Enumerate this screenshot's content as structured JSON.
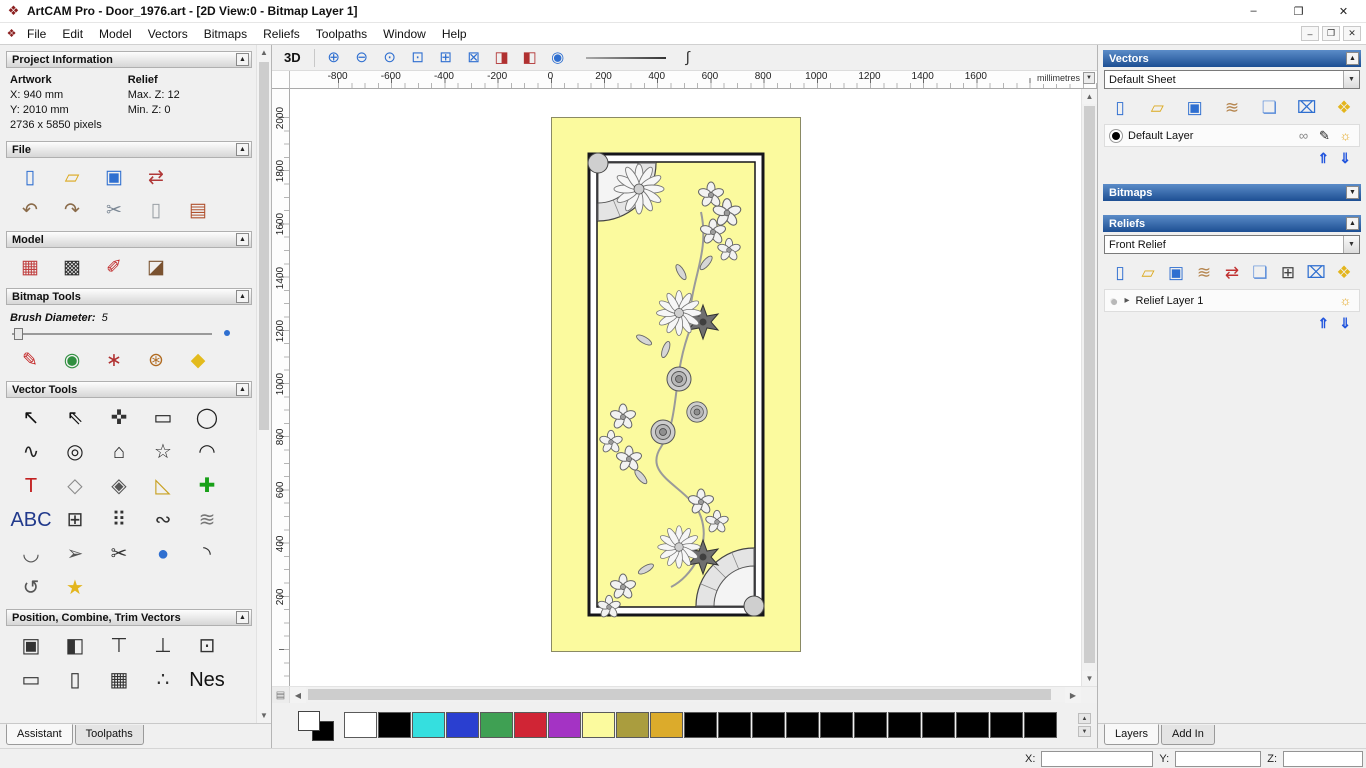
{
  "titlebar": {
    "title": "ArtCAM Pro - Door_1976.art - [2D View:0 - Bitmap Layer 1]",
    "logo_glyph": "❖",
    "minimize_glyph": "–",
    "maximize_glyph": "❐",
    "close_glyph": "✕"
  },
  "menubar": {
    "items": [
      {
        "name": "menu-file",
        "label": "File"
      },
      {
        "name": "menu-edit",
        "label": "Edit"
      },
      {
        "name": "menu-model",
        "label": "Model"
      },
      {
        "name": "menu-vectors",
        "label": "Vectors"
      },
      {
        "name": "menu-bitmaps",
        "label": "Bitmaps"
      },
      {
        "name": "menu-reliefs",
        "label": "Reliefs"
      },
      {
        "name": "menu-toolpaths",
        "label": "Toolpaths"
      },
      {
        "name": "menu-window",
        "label": "Window"
      },
      {
        "name": "menu-help",
        "label": "Help"
      }
    ],
    "child_minimize_glyph": "–",
    "child_restore_glyph": "❐",
    "child_close_glyph": "✕"
  },
  "assistant": {
    "project_info": {
      "title": "Project Information",
      "artwork_heading": "Artwork",
      "relief_heading": "Relief",
      "artwork_x": "X: 940 mm",
      "artwork_y": "Y: 2010 mm",
      "artwork_pixels": "2736 x 5850 pixels",
      "relief_max_z": "Max. Z: 12",
      "relief_min_z": "Min. Z: 0"
    },
    "file_section": {
      "title": "File",
      "icons_row1": [
        {
          "name": "new-model-icon",
          "glyph": "▯",
          "fg": "#2f6fd0"
        },
        {
          "name": "open-model-icon",
          "glyph": "▱",
          "fg": "#dca91e"
        },
        {
          "name": "save-model-icon",
          "glyph": "▣",
          "fg": "#2f6fd0"
        },
        {
          "name": "model-transfer-icon",
          "glyph": "⇄",
          "fg": "#b03838"
        }
      ],
      "icons_row2": [
        {
          "name": "undo-icon",
          "glyph": "↶",
          "fg": "#8a6b4a"
        },
        {
          "name": "redo-icon",
          "glyph": "↷",
          "fg": "#8a6b4a"
        },
        {
          "name": "cut-icon",
          "glyph": "✂",
          "fg": "#7b8794"
        },
        {
          "name": "paste-icon",
          "glyph": "▯",
          "fg": "#9aa0a6"
        },
        {
          "name": "notes-icon",
          "glyph": "▤",
          "fg": "#b0512e"
        }
      ]
    },
    "model_section": {
      "title": "Model",
      "icons": [
        {
          "name": "load-relief-icon",
          "glyph": "▦",
          "fg": "#c04040"
        },
        {
          "name": "greyscale-model-icon",
          "glyph": "▩",
          "fg": "#333333"
        },
        {
          "name": "sculpt-tool-icon",
          "glyph": "✐",
          "fg": "#c02828"
        },
        {
          "name": "load-bitmap-icon",
          "glyph": "◪",
          "fg": "#7a5230"
        }
      ]
    },
    "bitmap_tools": {
      "title": "Bitmap Tools",
      "brush_label": "Brush Diameter:",
      "brush_value": "5",
      "icons": [
        {
          "name": "paint-brush-icon",
          "glyph": "✎",
          "fg": "#c22020"
        },
        {
          "name": "draw-circles-icon",
          "glyph": "◉",
          "fg": "#2f8f3f"
        },
        {
          "name": "spray-brush-icon",
          "glyph": "∗",
          "fg": "#b03030"
        },
        {
          "name": "paint-palette-icon",
          "glyph": "⊛",
          "fg": "#b06a20"
        },
        {
          "name": "flood-fill-icon",
          "glyph": "◆",
          "fg": "#e3bb1d"
        }
      ]
    },
    "vector_tools": {
      "title": "Vector Tools",
      "icons": [
        {
          "name": "select-vectors-icon",
          "glyph": "↖",
          "fg": "#111111"
        },
        {
          "name": "node-editing-icon",
          "glyph": "⇖",
          "fg": "#111111"
        },
        {
          "name": "transform-vectors-icon",
          "glyph": "✜",
          "fg": "#333333"
        },
        {
          "name": "create-rectangle-icon",
          "glyph": "▭",
          "fg": "#222222"
        },
        {
          "name": "create-circle-icon",
          "glyph": "◯",
          "fg": "#222222"
        },
        {
          "name": "create-polyline-icon",
          "glyph": "∿",
          "fg": "#222222"
        },
        {
          "name": "create-ellipse-icon",
          "glyph": "◎",
          "fg": "#222222"
        },
        {
          "name": "create-polygon-icon",
          "glyph": "⌂",
          "fg": "#222222"
        },
        {
          "name": "create-star-icon",
          "glyph": "☆",
          "fg": "#222222"
        },
        {
          "name": "create-arc-icon",
          "glyph": "◠",
          "fg": "#222222"
        },
        {
          "name": "create-text-icon",
          "glyph": "T",
          "fg": "#c22020"
        },
        {
          "name": "envelope-distort-icon",
          "glyph": "◇",
          "fg": "#8a8a8a"
        },
        {
          "name": "offset-vectors-icon",
          "glyph": "◈",
          "fg": "#555555"
        },
        {
          "name": "measure-tool-icon",
          "glyph": "◺",
          "fg": "#c8a020"
        },
        {
          "name": "paste-special-icon",
          "glyph": "✚",
          "fg": "#18a018"
        },
        {
          "name": "text-on-curve-icon",
          "glyph": "ABC",
          "fg": "#223a8c"
        },
        {
          "name": "grid-copy-icon",
          "glyph": "⊞",
          "fg": "#333333"
        },
        {
          "name": "block-copy-icon",
          "glyph": "⠿",
          "fg": "#333333"
        },
        {
          "name": "copy-along-curve-icon",
          "glyph": "∾",
          "fg": "#333333"
        },
        {
          "name": "fit-arcs-icon",
          "glyph": "≋",
          "fg": "#777777"
        },
        {
          "name": "close-vector-icon",
          "glyph": "◡",
          "fg": "#555555"
        },
        {
          "name": "vector-doctor-icon",
          "glyph": "➢",
          "fg": "#555555"
        },
        {
          "name": "trim-vectors-icon",
          "glyph": "✂",
          "fg": "#333333"
        },
        {
          "name": "extrude-tool-icon",
          "glyph": "●",
          "fg": "#2f6fd0"
        },
        {
          "name": "fillet-tool-icon",
          "glyph": "◝",
          "fg": "#333333"
        },
        {
          "name": "weld-vectors-icon",
          "glyph": "↺",
          "fg": "#555555"
        },
        {
          "name": "wizard-star-icon",
          "glyph": "★",
          "fg": "#e3b51d"
        }
      ]
    },
    "position_section": {
      "title": "Position, Combine, Trim Vectors",
      "icons": [
        {
          "name": "center-in-page-icon",
          "glyph": "▣",
          "fg": "#333333"
        },
        {
          "name": "align-left-icon",
          "glyph": "◧",
          "fg": "#333333"
        },
        {
          "name": "align-top-icon",
          "glyph": "⊤",
          "fg": "#333333"
        },
        {
          "name": "align-bottom-icon",
          "glyph": "⊥",
          "fg": "#333333"
        },
        {
          "name": "align-corner-icon",
          "glyph": "⊡",
          "fg": "#333333"
        },
        {
          "name": "distribute-horizontal-icon",
          "glyph": "▭",
          "fg": "#333333"
        },
        {
          "name": "distribute-vertical-icon",
          "glyph": "▯",
          "fg": "#333333"
        },
        {
          "name": "group-vectors-icon",
          "glyph": "▦",
          "fg": "#333333"
        },
        {
          "name": "scatter-copies-icon",
          "glyph": "∴",
          "fg": "#333333"
        },
        {
          "name": "nest-vectors-icon",
          "glyph": "Nes",
          "fg": "#111111"
        }
      ]
    },
    "tabs": [
      {
        "name": "tab-assistant",
        "label": "Assistant"
      },
      {
        "name": "tab-toolpaths",
        "label": "Toolpaths"
      }
    ]
  },
  "canvas": {
    "toolbar": {
      "view3d_label": "3D",
      "icons": [
        {
          "name": "zoom-in-icon",
          "glyph": "⊕",
          "fg": "#2f6fd0"
        },
        {
          "name": "zoom-out-icon",
          "glyph": "⊖",
          "fg": "#2f6fd0"
        },
        {
          "name": "zoom-1to1-icon",
          "glyph": "⊙",
          "fg": "#2f6fd0"
        },
        {
          "name": "zoom-window-icon",
          "glyph": "⊡",
          "fg": "#2f6fd0"
        },
        {
          "name": "zoom-page-icon",
          "glyph": "⊞",
          "fg": "#2f6fd0"
        },
        {
          "name": "zoom-objects-icon",
          "glyph": "⊠",
          "fg": "#2f6fd0"
        },
        {
          "name": "toggle-bitmap-visibility-icon",
          "glyph": "◨",
          "fg": "#b03030"
        },
        {
          "name": "toggle-vector-visibility-icon",
          "glyph": "◧",
          "fg": "#b03030"
        },
        {
          "name": "simulate-view-icon",
          "glyph": "◉",
          "fg": "#2f6fd0"
        }
      ],
      "profile_icon": {
        "name": "profile-curve-icon",
        "glyph": "∫",
        "fg": "#333333"
      }
    },
    "rulers": {
      "h_labels": [
        "-800",
        "-600",
        "-400",
        "-200",
        "0",
        "200",
        "400",
        "600",
        "800",
        "1000",
        "1200",
        "1400",
        "1600"
      ],
      "v_labels": [
        "2000",
        "1800",
        "1600",
        "1400",
        "1200",
        "1000",
        "800",
        "600",
        "400",
        "200"
      ],
      "units_label": "millimetres"
    },
    "palette": {
      "primary": "#ffffff",
      "secondary": "#000000",
      "colors": [
        "#ffffff",
        "#000000",
        "#35dfdf",
        "#2a3fd0",
        "#3fa053",
        "#d02535",
        "#a433c4",
        "#fbfa9e",
        "#aa9d3e",
        "#dcab2b",
        "#000000",
        "#000000",
        "#000000",
        "#000000",
        "#000000",
        "#000000",
        "#000000",
        "#000000",
        "#000000",
        "#000000",
        "#000000"
      ]
    }
  },
  "right_panel": {
    "vectors": {
      "title": "Vectors",
      "collapse_glyph": "▲",
      "sheet_value": "Default Sheet",
      "toolbar": [
        {
          "name": "new-vector-layer-icon",
          "glyph": "▯",
          "fg": "#2f6fd0"
        },
        {
          "name": "open-vector-layer-icon",
          "glyph": "▱",
          "fg": "#dca91e"
        },
        {
          "name": "save-vector-layer-icon",
          "glyph": "▣",
          "fg": "#2f6fd0"
        },
        {
          "name": "merge-layers-icon",
          "glyph": "≋",
          "fg": "#b5854e"
        },
        {
          "name": "new-sheet-icon",
          "glyph": "❏",
          "fg": "#5b8dd9"
        },
        {
          "name": "delete-layer-icon",
          "glyph": "⌧",
          "fg": "#2f6fd0"
        },
        {
          "name": "toggle-all-layers-icon",
          "glyph": "❖",
          "fg": "#e3b51d"
        }
      ],
      "layer": {
        "label": "Default Layer",
        "swatch": "#000000",
        "icons": [
          {
            "name": "link-layer-icon",
            "glyph": "∞",
            "fg": "#888888"
          },
          {
            "name": "edit-layer-icon",
            "glyph": "✎",
            "fg": "#222222"
          },
          {
            "name": "layer-visibility-icon",
            "glyph": "☼",
            "fg": "#e3a51d"
          }
        ]
      },
      "move_up_glyph": "⇑",
      "move_down_glyph": "⇓"
    },
    "bitmaps": {
      "title": "Bitmaps",
      "collapse_glyph": "▼"
    },
    "reliefs": {
      "title": "Reliefs",
      "collapse_glyph": "▲",
      "relief_value": "Front Relief",
      "toolbar": [
        {
          "name": "new-relief-layer-icon",
          "glyph": "▯",
          "fg": "#2f6fd0"
        },
        {
          "name": "open-relief-icon",
          "glyph": "▱",
          "fg": "#dca91e"
        },
        {
          "name": "save-relief-icon",
          "glyph": "▣",
          "fg": "#2f6fd0"
        },
        {
          "name": "smooth-relief-icon",
          "glyph": "≋",
          "fg": "#b5854e"
        },
        {
          "name": "transfer-relief-icon",
          "glyph": "⇄",
          "fg": "#c03030"
        },
        {
          "name": "new-relief-sheet-icon",
          "glyph": "❏",
          "fg": "#5b8dd9"
        },
        {
          "name": "calculate-relief-icon",
          "glyph": "⊞",
          "fg": "#444444"
        },
        {
          "name": "delete-relief-icon",
          "glyph": "⌧",
          "fg": "#2f6fd0"
        },
        {
          "name": "toggle-relief-layers-icon",
          "glyph": "❖",
          "fg": "#e3b51d"
        }
      ],
      "layer": {
        "label": "Relief Layer 1",
        "expander_glyph": "▸",
        "thumb_glyph": "●",
        "bulb_glyph": "☼"
      },
      "move_up_glyph": "⇑",
      "move_down_glyph": "⇓"
    },
    "tabs": [
      {
        "name": "tab-layers",
        "label": "Layers"
      },
      {
        "name": "tab-add-in",
        "label": "Add In"
      }
    ]
  },
  "statusbar": {
    "x_label": "X:",
    "y_label": "Y:",
    "z_label": "Z:",
    "x_value": "",
    "y_value": "",
    "z_value": ""
  },
  "glyphs": {
    "up": "▲",
    "down": "▼",
    "left": "◀",
    "right": "▶"
  }
}
